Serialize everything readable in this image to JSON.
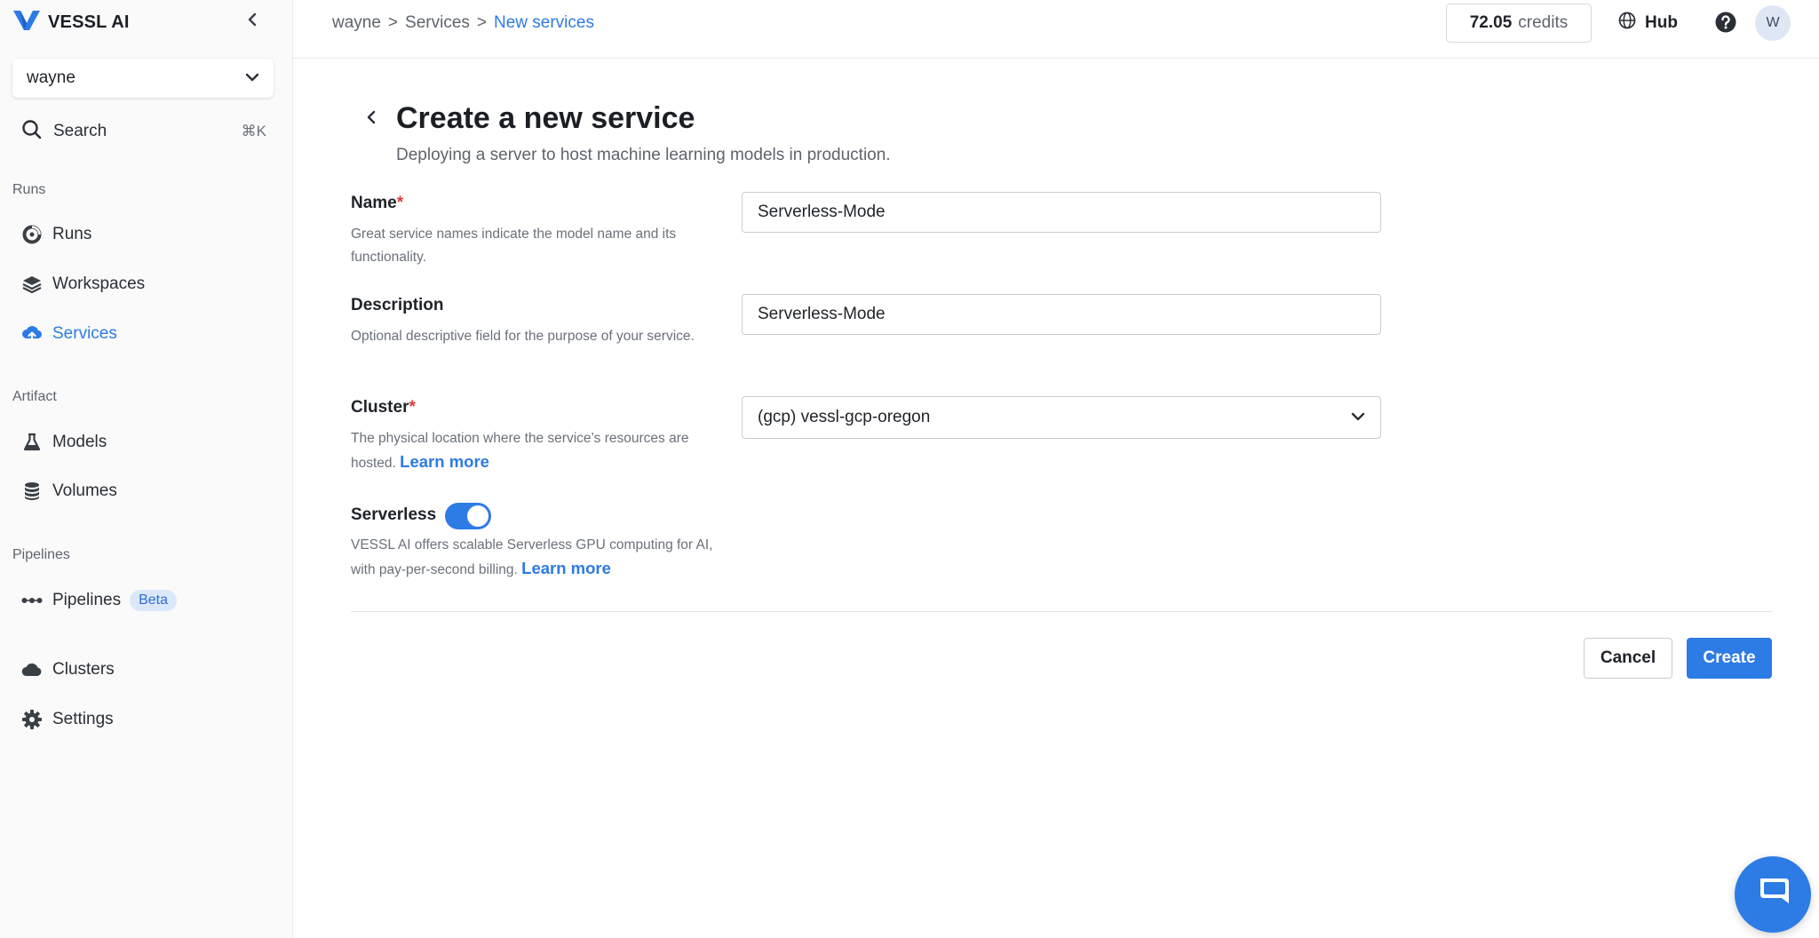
{
  "app": {
    "brand": "VESSL AI"
  },
  "sidebar": {
    "org": "wayne",
    "search_label": "Search",
    "search_shortcut": "⌘K",
    "sections": {
      "runs": "Runs",
      "artifact": "Artifact",
      "pipelines": "Pipelines"
    },
    "items": {
      "runs": "Runs",
      "workspaces": "Workspaces",
      "services": "Services",
      "models": "Models",
      "volumes": "Volumes",
      "pipelines": "Pipelines",
      "pipelines_badge": "Beta",
      "clusters": "Clusters",
      "settings": "Settings"
    },
    "active_item": "services"
  },
  "header": {
    "breadcrumb": [
      "wayne",
      "Services",
      "New services"
    ],
    "breadcrumb_sep": ">",
    "credits_value": "72.05",
    "credits_unit": "credits",
    "hub_label": "Hub",
    "avatar_initial": "W"
  },
  "form": {
    "title": "Create a new service",
    "subtitle": "Deploying a server to host machine learning models in production.",
    "name": {
      "label": "Name",
      "required": "*",
      "help": "Great service names indicate the model name and its functionality.",
      "value": "Serverless-Mode"
    },
    "description": {
      "label": "Description",
      "help": "Optional descriptive field for the purpose of your service.",
      "value": "Serverless-Mode"
    },
    "cluster": {
      "label": "Cluster",
      "required": "*",
      "help": "The physical location where the service’s resources are hosted.",
      "link": "Learn more",
      "value": "(gcp) vessl-gcp-oregon"
    },
    "serverless": {
      "label": "Serverless",
      "enabled": true,
      "help": "VESSL AI offers scalable Serverless GPU computing for AI, with pay-per-second billing.",
      "link": "Learn more"
    },
    "cancel_label": "Cancel",
    "create_label": "Create"
  },
  "colors": {
    "accent": "#2d7be5",
    "required": "#e03c3c",
    "badge_bg": "#dbe8fb"
  },
  "icons": {
    "logo": "vessl-logo-icon",
    "collapse": "chevron-left-icon",
    "org_dropdown": "chevron-down-icon",
    "search": "search-icon",
    "runs": "runs-icon",
    "workspaces": "layers-icon",
    "services": "cloud-upload-icon",
    "models": "flask-icon",
    "volumes": "database-icon",
    "pipelines": "pipeline-dots-icon",
    "clusters": "cloud-icon",
    "settings": "gear-icon",
    "hub": "globe-icon",
    "help": "help-icon",
    "back": "chevron-left-icon",
    "cluster_dropdown": "chevron-down-icon",
    "chat": "chat-icon"
  }
}
